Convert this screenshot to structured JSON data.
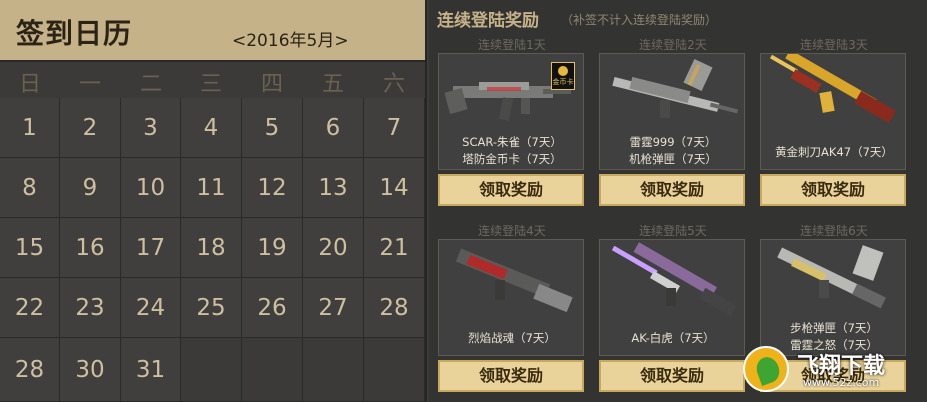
{
  "calendar": {
    "title": "签到日历",
    "month_label": "<2016年5月>",
    "weekdays": [
      "日",
      "一",
      "二",
      "三",
      "四",
      "五",
      "六"
    ],
    "weeks": [
      [
        "1",
        "2",
        "3",
        "4",
        "5",
        "6",
        "7"
      ],
      [
        "8",
        "9",
        "10",
        "11",
        "12",
        "13",
        "14"
      ],
      [
        "15",
        "16",
        "17",
        "18",
        "19",
        "20",
        "21"
      ],
      [
        "22",
        "23",
        "24",
        "25",
        "26",
        "27",
        "28"
      ],
      [
        "28",
        "30",
        "31",
        "",
        "",
        "",
        ""
      ]
    ]
  },
  "rewards": {
    "title": "连续登陆奖励",
    "note": "（补签不计入连续登陆奖励）",
    "items": [
      {
        "day": "连续登陆1天",
        "line1": "SCAR-朱雀（7天）",
        "line2": "塔防金币卡（7天）",
        "button": "领取奖励",
        "badge": "金币卡",
        "icon": "scar-rifle-icon"
      },
      {
        "day": "连续登陆2天",
        "line1": "雷霆999（7天）",
        "line2": "机枪弹匣（7天）",
        "button": "领取奖励",
        "icon": "machine-gun-icon"
      },
      {
        "day": "连续登陆3天",
        "line1": "黄金刺刀AK47（7天）",
        "line2": "",
        "button": "领取奖励",
        "icon": "gold-ak47-icon"
      },
      {
        "day": "连续登陆4天",
        "line1": "烈焰战魂（7天）",
        "line2": "",
        "button": "领取奖励",
        "icon": "flame-rifle-icon"
      },
      {
        "day": "连续登陆5天",
        "line1": "AK-白虎（7天）",
        "line2": "",
        "button": "领取奖励",
        "icon": "ak-white-tiger-icon"
      },
      {
        "day": "连续登陆6天",
        "line1": "步枪弹匣（7天）",
        "line2": "雷霆之怒（7天）",
        "button": "领取奖励",
        "icon": "rifle-magazine-icon"
      }
    ]
  },
  "watermark": {
    "name": "飞翔下载",
    "url": "www.52z.com"
  },
  "colors": {
    "accent": "#c6b288",
    "button": "#e9d39a",
    "gold": "#e4b93c"
  }
}
